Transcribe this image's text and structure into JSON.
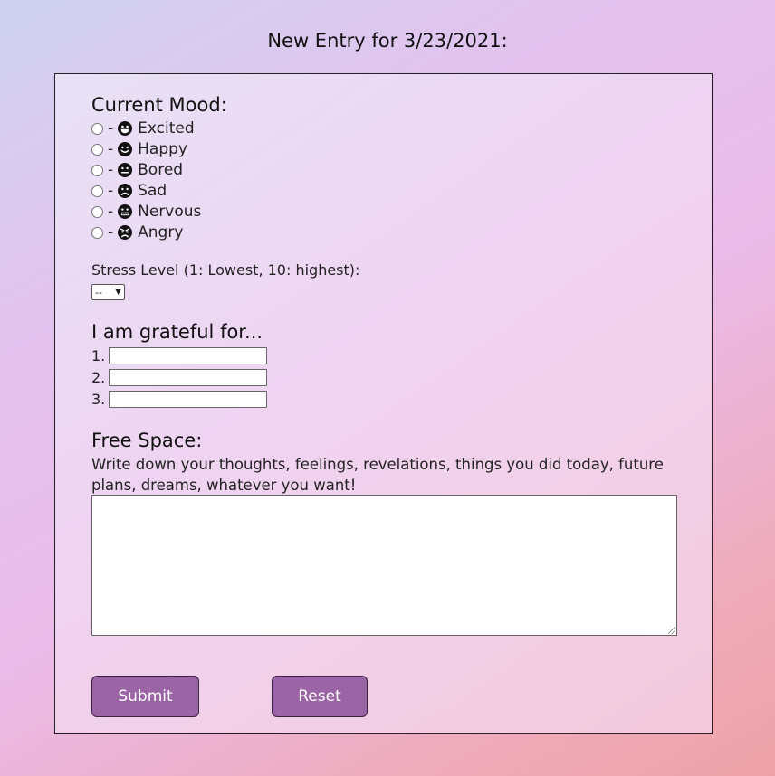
{
  "page": {
    "title": "New Entry for 3/23/2021:"
  },
  "mood": {
    "heading": "Current Mood:",
    "options": [
      {
        "label": "Excited",
        "icon": "excited-face-icon"
      },
      {
        "label": "Happy",
        "icon": "happy-face-icon"
      },
      {
        "label": "Bored",
        "icon": "neutral-face-icon"
      },
      {
        "label": "Sad",
        "icon": "sad-face-icon"
      },
      {
        "label": "Nervous",
        "icon": "grimacing-face-icon"
      },
      {
        "label": "Angry",
        "icon": "angry-face-icon"
      }
    ],
    "separator": "-"
  },
  "stress": {
    "label": "Stress Level (1: Lowest, 10: highest):",
    "selected": "--"
  },
  "grateful": {
    "heading": "I am grateful for...",
    "items": [
      {
        "number": "1.",
        "value": ""
      },
      {
        "number": "2.",
        "value": ""
      },
      {
        "number": "3.",
        "value": ""
      }
    ]
  },
  "free_space": {
    "heading": "Free Space:",
    "description": "Write down your thoughts, feelings, revelations, things you did today, future plans, dreams, whatever you want!",
    "value": ""
  },
  "buttons": {
    "submit": "Submit",
    "reset": "Reset"
  },
  "colors": {
    "button_bg": "#9b64a4",
    "panel_border": "#222222"
  }
}
